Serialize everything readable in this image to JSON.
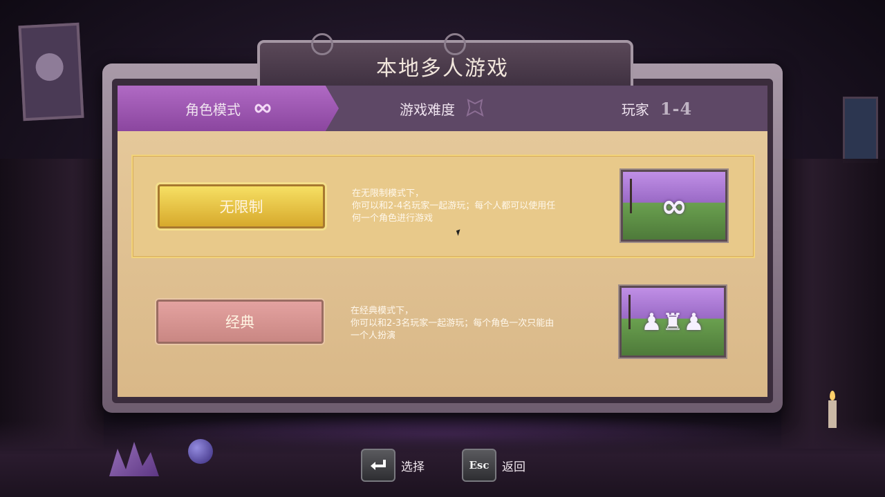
{
  "title": "本地多人游戏",
  "tabs": [
    {
      "label": "角色模式",
      "icon": "infinity-icon",
      "active": true
    },
    {
      "label": "游戏难度",
      "icon": "butterfly-icon",
      "active": false
    },
    {
      "label": "玩家",
      "badge": "1-4",
      "active": false
    }
  ],
  "modes": [
    {
      "label": "无限制",
      "selected": true,
      "description": [
        "在无限制模式下，",
        "你可以和2-4名玩家一起游玩；每个人都可以使用任",
        "何一个角色进行游戏"
      ],
      "thumbnail_icon": "infinity-icon"
    },
    {
      "label": "经典",
      "selected": false,
      "description": [
        "在经典模式下，",
        "你可以和2-3名玩家一起游玩；每个角色一次只能由",
        "一个人扮演"
      ],
      "thumbnail_icon": "characters-icon"
    }
  ],
  "hints": {
    "select": {
      "key_icon": "enter-key-icon",
      "label": "选择"
    },
    "back": {
      "key": "Esc",
      "label": "返回"
    }
  },
  "colors": {
    "tab_active": "#9b52b0",
    "selected_button": "#e8c43e",
    "content_bg": "#dfc092"
  }
}
